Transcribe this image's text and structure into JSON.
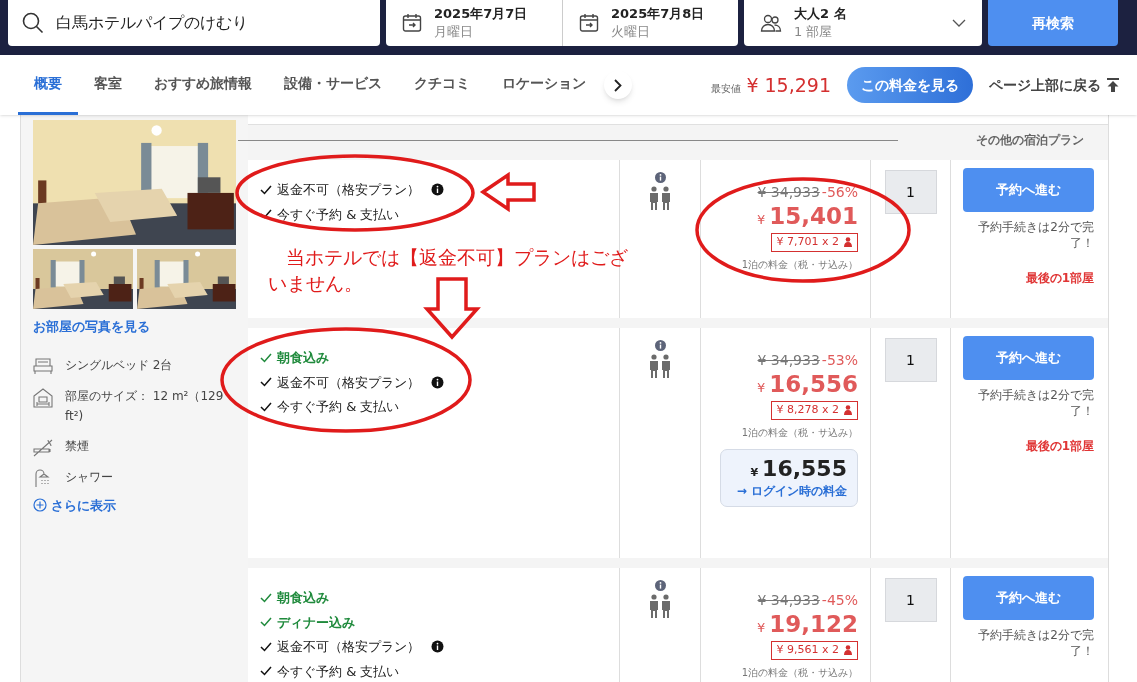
{
  "search": {
    "value": "白馬ホテルパイプのけむり"
  },
  "checkin": {
    "date": "2025年7月7日",
    "weekday": "月曜日"
  },
  "checkout": {
    "date": "2025年7月8日",
    "weekday": "火曜日"
  },
  "guests": {
    "adults": "大人2 名",
    "rooms": "1 部屋"
  },
  "search_button": "再検索",
  "tabs": [
    {
      "label": "概要",
      "selected": true
    },
    {
      "label": "客室",
      "selected": false
    },
    {
      "label": "おすすめ旅情報",
      "selected": false
    },
    {
      "label": "設備・サービス",
      "selected": false
    },
    {
      "label": "クチコミ",
      "selected": false
    },
    {
      "label": "ロケーション",
      "selected": false
    }
  ],
  "lowest_price": {
    "label": "最安値",
    "currency": "¥",
    "amount": "15,291"
  },
  "see_price_button": "この料金を見る",
  "back_to_top": "ページ上部に戻る",
  "room": {
    "photos_link": "お部屋の写真を見る",
    "features": [
      {
        "kind": "bed",
        "text": "シングルベッド 2台"
      },
      {
        "kind": "size",
        "text": "部屋のサイズ： 12 m²（129 ft²)"
      },
      {
        "kind": "nosmoking",
        "text": "禁煙"
      },
      {
        "kind": "shower",
        "text": "シャワー"
      }
    ],
    "more_link": "さらに表示"
  },
  "plans_header": "その他の宿泊プラン",
  "plans": [
    {
      "inclusions": [
        {
          "kind": "refund",
          "text": "返金不可（格安プラン）"
        },
        {
          "kind": "payment",
          "text": "今すぐ予約 & 支払い"
        }
      ],
      "original_price": "¥ 34,933",
      "discount": "-56%",
      "currency": "¥",
      "price": "15,401",
      "per_person": "¥ 7,701 x 2",
      "price_note": "1泊の料金（税・サ込み）",
      "quantity": "1",
      "book_button": "予約へ進む",
      "book_note": "予約手続きは2分で完了！",
      "availability": "最後の1部屋"
    },
    {
      "inclusions": [
        {
          "kind": "meal",
          "text": "朝食込み"
        },
        {
          "kind": "refund",
          "text": "返金不可（格安プラン）"
        },
        {
          "kind": "payment",
          "text": "今すぐ予約 & 支払い"
        }
      ],
      "original_price": "¥ 34,933",
      "discount": "-53%",
      "currency": "¥",
      "price": "16,556",
      "per_person": "¥ 8,278 x 2",
      "price_note": "1泊の料金（税・サ込み）",
      "member_price": {
        "currency": "¥",
        "amount": "16,555",
        "link": "→ ログイン時の料金"
      },
      "quantity": "1",
      "book_button": "予約へ進む",
      "book_note": "予約手続きは2分で完了！",
      "availability": "最後の1部屋"
    },
    {
      "inclusions": [
        {
          "kind": "meal",
          "text": "朝食込み"
        },
        {
          "kind": "meal",
          "text": "ディナー込み"
        },
        {
          "kind": "refund",
          "text": "返金不可（格安プラン）"
        },
        {
          "kind": "payment",
          "text": "今すぐ予約 & 支払い"
        }
      ],
      "original_price": "¥ 34,933",
      "discount": "-45%",
      "currency": "¥",
      "price": "19,122",
      "per_person": "¥ 9,561 x 2",
      "price_note": "1泊の料金（税・サ込み）",
      "quantity": "1",
      "book_button": "予約へ進む",
      "book_note": "予約手続きは2分で完了！"
    }
  ],
  "annotation": {
    "note": "当ホテルでは【返金不可】プランはございません。"
  }
}
